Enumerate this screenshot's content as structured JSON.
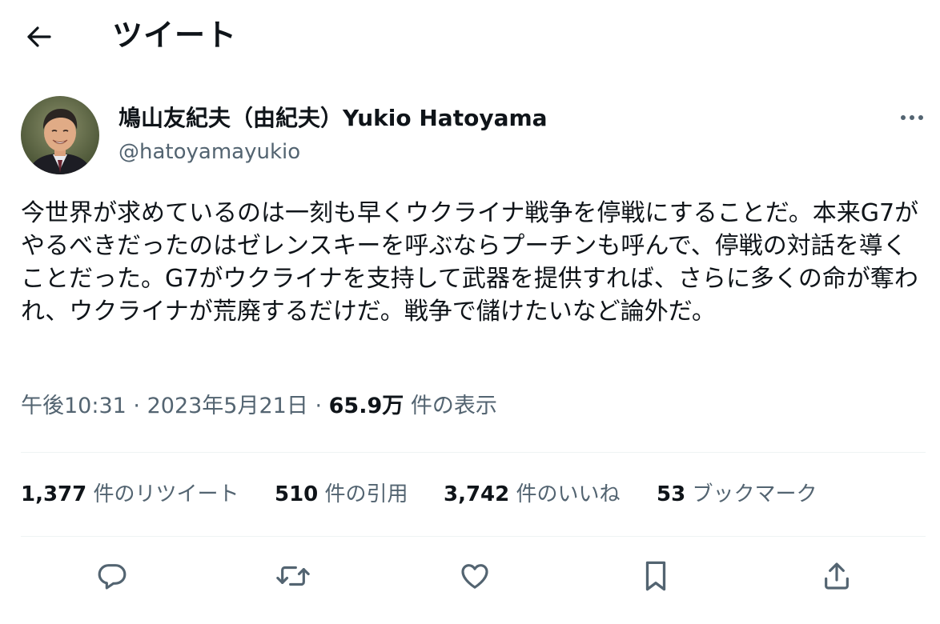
{
  "header": {
    "title": "ツイート",
    "back_icon": "arrow-left-icon"
  },
  "author": {
    "display_name": "鳩山友紀夫（由紀夫）Yukio Hatoyama",
    "handle": "@hatoyamayukio",
    "more_icon": "more-horizontal-icon"
  },
  "tweet": {
    "text": "今世界が求めているのは一刻も早くウクライナ戦争を停戦にすることだ。本来G7がやるべきだったのはゼレンスキーを呼ぶならプーチンも呼んで、停戦の対話を導くことだった。G7がウクライナを支持して武器を提供すれば、さらに多くの命が奪われ、ウクライナが荒廃するだけだ。戦争で儲けたいなど論外だ。"
  },
  "meta": {
    "time": "午後10:31",
    "separator": "·",
    "date": "2023年5月21日",
    "views_count": "65.9万",
    "views_label": "件の表示"
  },
  "stats": {
    "retweets": {
      "count": "1,377",
      "label": "件のリツイート"
    },
    "quotes": {
      "count": "510",
      "label": "件の引用"
    },
    "likes": {
      "count": "3,742",
      "label": "件のいいね"
    },
    "bookmarks": {
      "count": "53",
      "label": "ブックマーク"
    }
  },
  "actions": {
    "reply_icon": "reply-icon",
    "retweet_icon": "retweet-icon",
    "like_icon": "heart-icon",
    "bookmark_icon": "bookmark-icon",
    "share_icon": "share-icon"
  },
  "colors": {
    "text_primary": "#0f1419",
    "text_secondary": "#536471",
    "divider": "#eff3f4",
    "background": "#ffffff"
  }
}
